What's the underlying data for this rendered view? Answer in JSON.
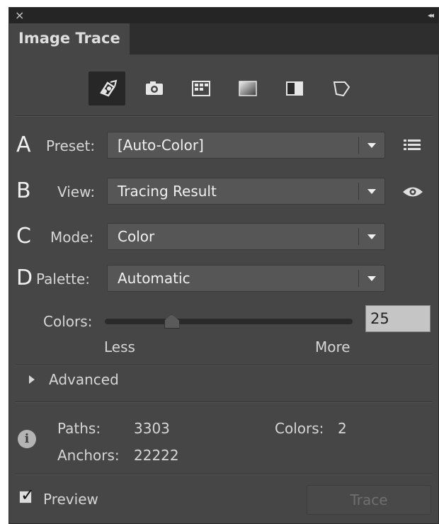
{
  "window": {
    "close_glyph": "×",
    "collapse_glyph": "◂◂"
  },
  "panel": {
    "title": "Image Trace"
  },
  "preset_icons": [
    {
      "name": "auto-color-icon",
      "active": true
    },
    {
      "name": "high-color-icon",
      "active": false
    },
    {
      "name": "low-color-icon",
      "active": false
    },
    {
      "name": "grayscale-icon",
      "active": false
    },
    {
      "name": "black-and-white-icon",
      "active": false
    },
    {
      "name": "outline-icon",
      "active": false
    }
  ],
  "rows": {
    "preset": {
      "letter": "A",
      "label": "Preset:",
      "value": "[Auto-Color]"
    },
    "view": {
      "letter": "B",
      "label": "View:",
      "value": "Tracing Result"
    },
    "mode": {
      "letter": "C",
      "label": "Mode:",
      "value": "Color"
    },
    "palette": {
      "letter": "D",
      "label": "Palette:",
      "value": "Automatic"
    }
  },
  "colors": {
    "label": "Colors:",
    "value": "25",
    "slider_fraction": 0.27,
    "less": "Less",
    "more": "More"
  },
  "advanced": {
    "label": "Advanced"
  },
  "stats": {
    "paths_label": "Paths:",
    "paths_value": "3303",
    "colors_label": "Colors:",
    "colors_value": "2",
    "anchors_label": "Anchors:",
    "anchors_value": "22222"
  },
  "footer": {
    "preview_label": "Preview",
    "preview_checked": true,
    "trace_label": "Trace"
  }
}
